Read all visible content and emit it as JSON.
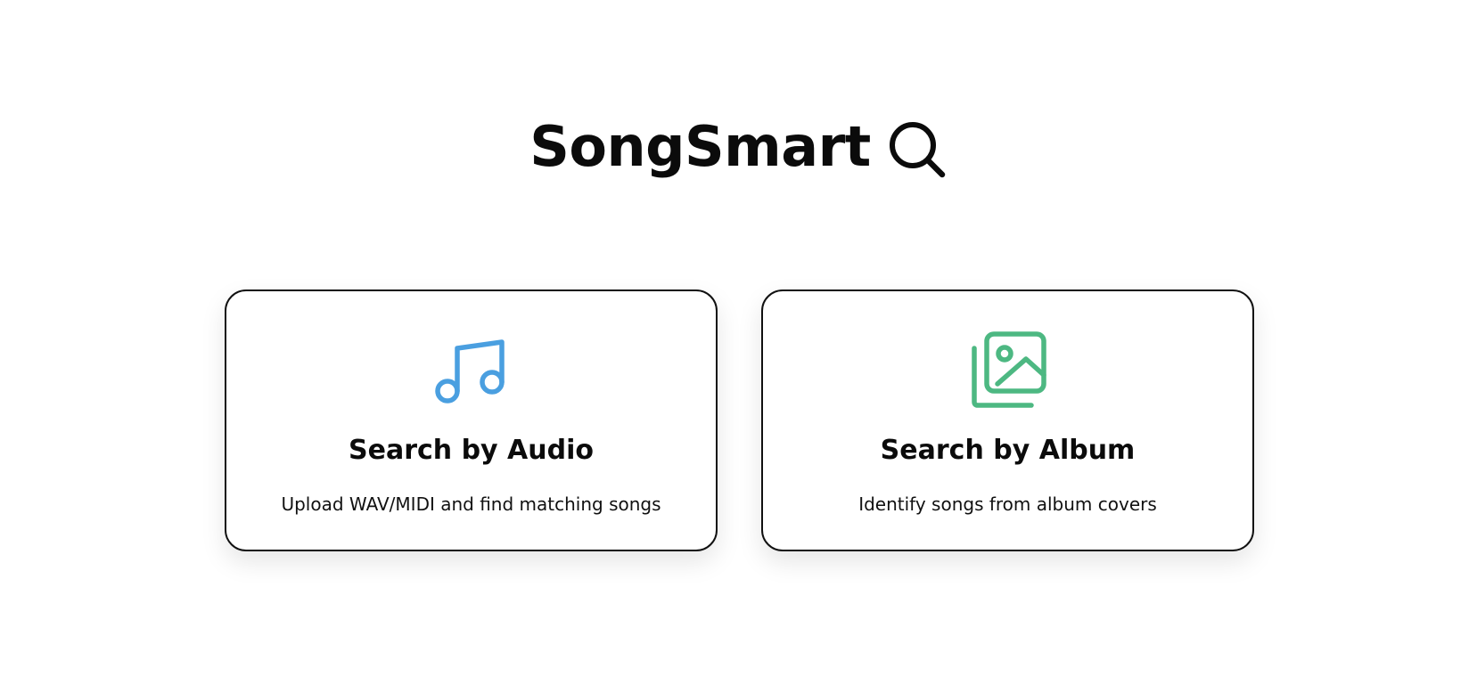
{
  "header": {
    "title": "SongSmart",
    "icon": "search-icon"
  },
  "cards": [
    {
      "title": "Search by Audio",
      "description": "Upload WAV/MIDI and find matching songs",
      "icon": "music-note-icon",
      "icon_color": "#4a9fe0"
    },
    {
      "title": "Search by Album",
      "description": "Identify songs from album covers",
      "icon": "image-gallery-icon",
      "icon_color": "#4db882"
    }
  ]
}
